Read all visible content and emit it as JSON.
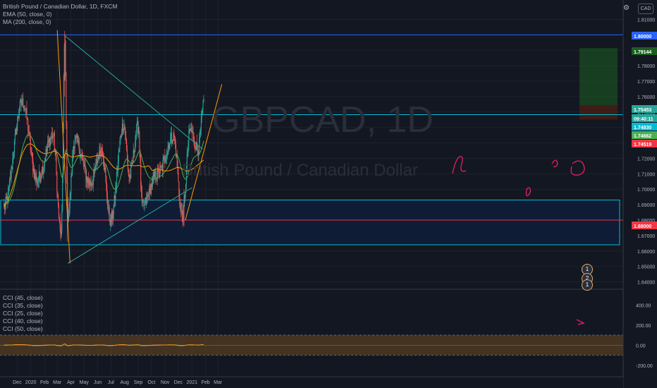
{
  "header": {
    "legend": [
      "British Pound / Canadian Dollar, 1D, FXCM",
      "EMA (50, close, 0)",
      "MA (200, close, 0)"
    ],
    "cci_legend": [
      "CCI (45, close)",
      "CCI (35, close)",
      "CCI (25, close)",
      "CCI (40, close)",
      "CCI (50, close)"
    ],
    "currency_button": "CAD",
    "watermark_symbol": "GBPCAD, 1D",
    "watermark_name": "British Pound / Canadian Dollar",
    "events": [
      "1",
      "2",
      "1"
    ]
  },
  "colors": {
    "bg": "#131722",
    "up": "#26a69a",
    "down": "#ef5350",
    "ema": "#4caf50",
    "ma": "#ff9800",
    "trend": "#26a69a",
    "hline_blue": "#2962ff",
    "hline_cyan": "#00bcd4",
    "hline_red": "#f23645",
    "drawing": "#e91e63",
    "target_zone": "#1b5e20"
  },
  "chart_data": [
    {
      "type": "candlestick",
      "title": "British Pound / Canadian Dollar, 1D, FXCM",
      "x_ticks": [
        "Dec",
        "2020",
        "Feb",
        "Mar",
        "Apr",
        "May",
        "Jun",
        "Jul",
        "Aug",
        "Sep",
        "Oct",
        "Nov",
        "Dec",
        "2021",
        "Feb",
        "Mar"
      ],
      "y_ticks": [
        "1.81000",
        "1.80000",
        "1.79000",
        "1.78000",
        "1.77000",
        "1.76000",
        "1.75000",
        "1.74000",
        "1.73000",
        "1.72000",
        "1.71000",
        "1.70000",
        "1.69000",
        "1.68000",
        "1.67000",
        "1.66000",
        "1.65000",
        "1.64000"
      ],
      "ylim": [
        1.6375,
        1.8125
      ],
      "price_labels": [
        {
          "text": "1.80000",
          "color": "#2962ff"
        },
        {
          "text": "1.79144",
          "color": "#1b5e20"
        },
        {
          "text": "1.75453",
          "color": "#26a69a"
        },
        {
          "text": "09:40:11",
          "color": "#26a69a"
        },
        {
          "text": "1.74830",
          "color": "#00bcd4"
        },
        {
          "text": "1.74662",
          "color": "#4caf50"
        },
        {
          "text": "1.74519",
          "color": "#f23645"
        },
        {
          "text": "1.68000",
          "color": "#f23645"
        }
      ],
      "key_points": [
        {
          "date": "2019-11-01",
          "close": 1.689
        },
        {
          "date": "2019-12-13",
          "close": 1.756
        },
        {
          "date": "2020-01-15",
          "close": 1.706
        },
        {
          "date": "2020-02-20",
          "close": 1.735
        },
        {
          "date": "2020-03-10",
          "close": 1.67
        },
        {
          "date": "2020-03-18",
          "close": 1.795
        },
        {
          "date": "2020-03-25",
          "close": 1.683
        },
        {
          "date": "2020-04-10",
          "close": 1.732
        },
        {
          "date": "2020-05-15",
          "close": 1.704
        },
        {
          "date": "2020-06-10",
          "close": 1.726
        },
        {
          "date": "2020-06-30",
          "close": 1.68
        },
        {
          "date": "2020-07-30",
          "close": 1.742
        },
        {
          "date": "2020-08-12",
          "close": 1.708
        },
        {
          "date": "2020-09-01",
          "close": 1.741
        },
        {
          "date": "2020-09-10",
          "close": 1.689
        },
        {
          "date": "2020-10-15",
          "close": 1.71
        },
        {
          "date": "2020-11-20",
          "close": 1.734
        },
        {
          "date": "2020-12-10",
          "close": 1.683
        },
        {
          "date": "2020-12-28",
          "close": 1.738
        },
        {
          "date": "2021-01-15",
          "close": 1.726
        },
        {
          "date": "2021-01-28",
          "close": 1.7545
        }
      ],
      "horizontal_levels": [
        1.8,
        1.7483,
        1.68
      ],
      "support_zone": [
        1.664,
        1.693
      ],
      "target_zone": [
        1.7452,
        1.7914
      ]
    },
    {
      "type": "line",
      "title": "CCI",
      "y_ticks": [
        "400.00",
        "200.00",
        "0.00",
        "-200.00"
      ],
      "ylim": [
        -300,
        500
      ],
      "band": [
        -100,
        100
      ],
      "series": [
        {
          "name": "CCI (45, close)",
          "color": "#2196f3"
        },
        {
          "name": "CCI (35, close)",
          "color": "#3f51b5"
        },
        {
          "name": "CCI (25, close)",
          "color": "#f44336"
        },
        {
          "name": "CCI (40, close)",
          "color": "#9e9e9e"
        },
        {
          "name": "CCI (50, close)",
          "color": "#ff9800"
        }
      ]
    }
  ]
}
